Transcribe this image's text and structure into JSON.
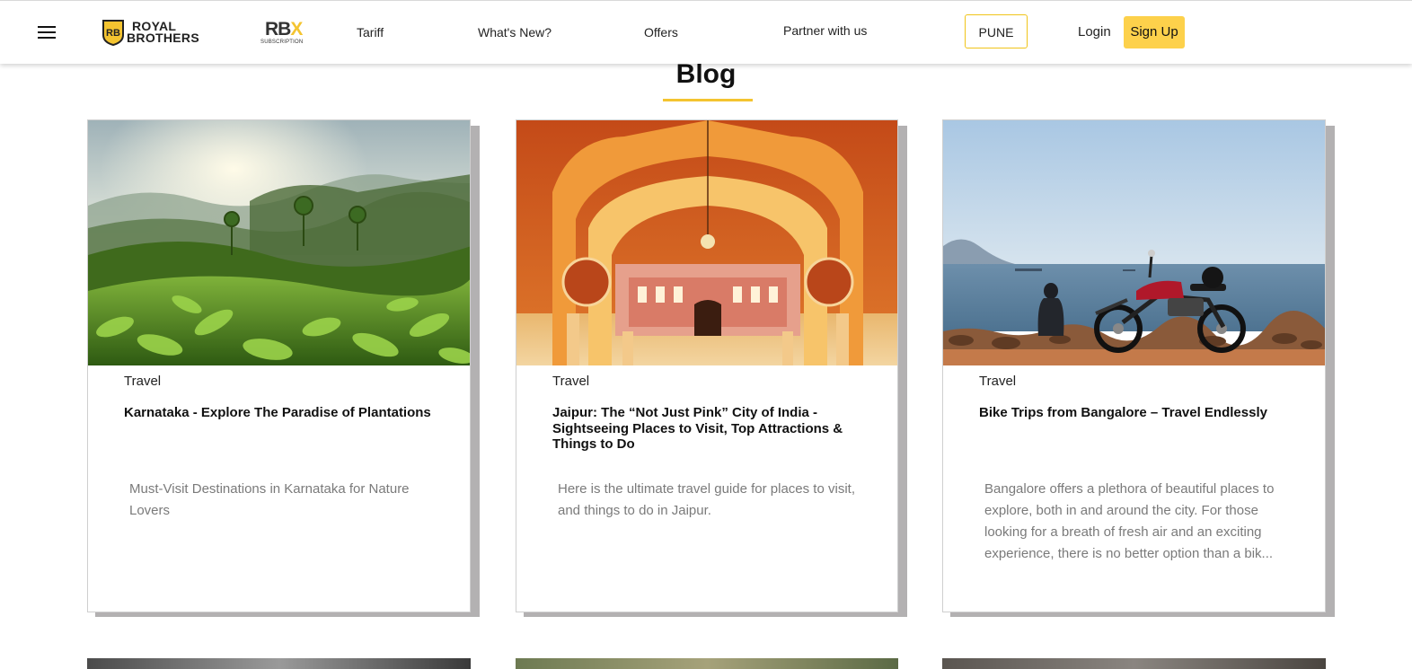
{
  "header": {
    "logo_text_line1": "ROYAL",
    "logo_text_line2": "BROTHERS",
    "logo_badge": "RB",
    "subscription_logo_main": "RB",
    "subscription_logo_accent": "X",
    "subscription_logo_sub": "SUBSCRIPTION",
    "nav": [
      "Tariff",
      "What's New?",
      "Offers",
      "Partner with us"
    ],
    "city": "PUNE",
    "login": "Login",
    "signup": "Sign Up",
    "accent_color": "#fdd14b"
  },
  "blog": {
    "heading": "Blog",
    "cards": [
      {
        "category": "Travel",
        "title": "Karnataka - Explore The Paradise of Plantations",
        "excerpt": "Must-Visit Destinations in Karnataka for Nature Lovers",
        "image": "tea-plantation-hills"
      },
      {
        "category": "Travel",
        "title": "Jaipur: The “Not Just Pink” City of India - Sightseeing Places to Visit, Top Attractions & Things to Do",
        "excerpt": "Here is the ultimate travel guide for places to visit, and things to do in Jaipur.",
        "image": "jaipur-palace-arches"
      },
      {
        "category": "Travel",
        "title": "Bike Trips from Bangalore – Travel Endlessly",
        "excerpt": "Bangalore offers a plethora of beautiful places to explore, both in and around the city. For those looking for a breath of fresh air and an exciting experience, there is no better option than a bik...",
        "image": "motorcycle-by-sea"
      }
    ]
  }
}
